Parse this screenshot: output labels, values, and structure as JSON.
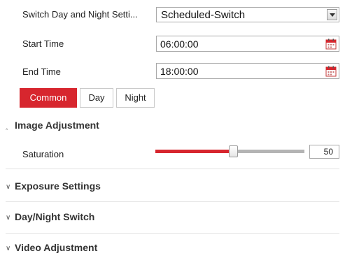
{
  "settings": {
    "switch_label": "Switch Day and Night Setti...",
    "switch_value": "Scheduled-Switch",
    "start_time_label": "Start Time",
    "start_time_value": "06:00:00",
    "end_time_label": "End Time",
    "end_time_value": "18:00:00"
  },
  "tabs": [
    {
      "label": "Common",
      "active": true
    },
    {
      "label": "Day",
      "active": false
    },
    {
      "label": "Night",
      "active": false
    }
  ],
  "sections": {
    "image_adjustment": {
      "title": "Image Adjustment",
      "expanded": true,
      "saturation_label": "Saturation",
      "saturation_value": "50",
      "saturation_fraction": 0.5
    },
    "exposure": {
      "title": "Exposure Settings",
      "expanded": false
    },
    "day_night": {
      "title": "Day/Night Switch",
      "expanded": false
    },
    "video": {
      "title": "Video Adjustment",
      "expanded": false
    }
  },
  "icons": {
    "dropdown": "chevron-down-icon",
    "calendar": "calendar-icon",
    "collapse": "chevron-up-icon",
    "expand": "chevron-down-icon"
  },
  "colors": {
    "accent": "#d7262e",
    "track": "#b4b4b4",
    "border": "#a9a9a9"
  }
}
